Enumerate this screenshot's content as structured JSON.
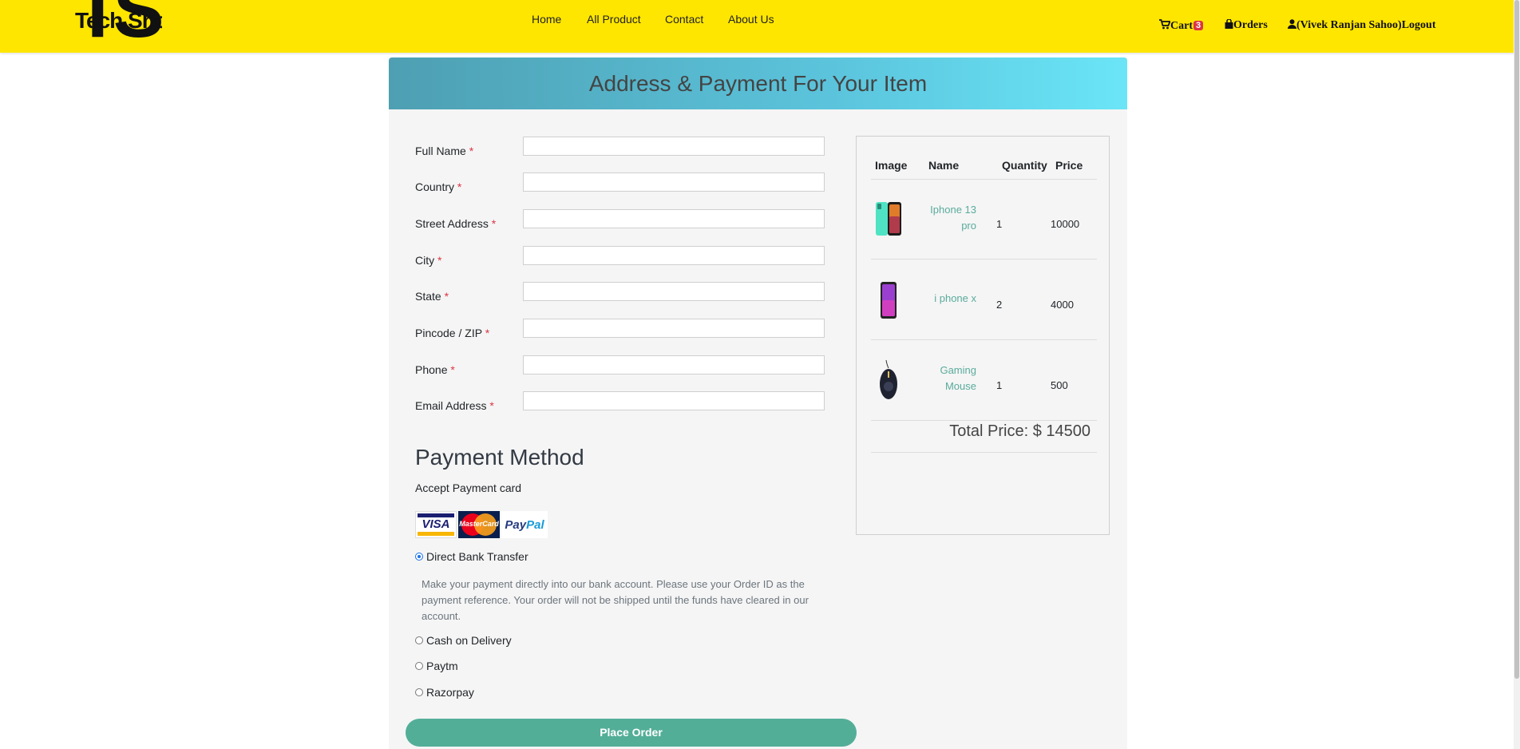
{
  "brand": {
    "logo_text": "Tech Shop",
    "logo_mark": "TS",
    "color": "#ffe600"
  },
  "nav": {
    "items": [
      "Home",
      "All Product",
      "Contact",
      "About Us"
    ]
  },
  "account_nav": {
    "cart_label": "Cart",
    "cart_count": "3",
    "orders_label": "Orders",
    "user_label": "(Vivek Ranjan Sahoo)Logout"
  },
  "page": {
    "title": "Address & Payment For Your Item"
  },
  "form": {
    "required_mark": "*",
    "fields": [
      {
        "label": "Full Name",
        "value": ""
      },
      {
        "label": "Country",
        "value": ""
      },
      {
        "label": "Street Address",
        "value": ""
      },
      {
        "label": "City",
        "value": ""
      },
      {
        "label": "State",
        "value": ""
      },
      {
        "label": "Pincode / ZIP",
        "value": ""
      },
      {
        "label": "Phone",
        "value": ""
      },
      {
        "label": "Email Address",
        "value": ""
      }
    ]
  },
  "payment": {
    "title": "Payment Method",
    "subtitle": "Accept Payment card",
    "card_logos": {
      "visa": "VISA",
      "mastercard": "MasterCard",
      "paypal_a": "Pay",
      "paypal_b": "Pal"
    },
    "options": [
      {
        "label": "Direct Bank Transfer",
        "selected": true
      },
      {
        "label": "Cash on Delivery",
        "selected": false
      },
      {
        "label": "Paytm",
        "selected": false
      },
      {
        "label": "Razorpay",
        "selected": false
      }
    ],
    "bank_description": "Make your payment directly into our bank account. Please use your Order ID as the payment reference. Your order will not be shipped until the funds have cleared in our account.",
    "place_order_label": "Place Order",
    "accent_color": "#53ae98"
  },
  "summary": {
    "headers": {
      "image": "Image",
      "name": "Name",
      "quantity": "Quantity",
      "price": "Price"
    },
    "items": [
      {
        "name_line1": "Iphone 13",
        "name_line2": "pro",
        "quantity": "1",
        "price": "10000",
        "icon": "green-phone-image"
      },
      {
        "name_line1": "i phone x",
        "name_line2": "",
        "quantity": "2",
        "price": "4000",
        "icon": "purple-phone-image"
      },
      {
        "name_line1": "Gaming",
        "name_line2": "Mouse",
        "quantity": "1",
        "price": "500",
        "icon": "gaming-mouse-image"
      }
    ],
    "total_label": "Total Price: $ 14500"
  }
}
